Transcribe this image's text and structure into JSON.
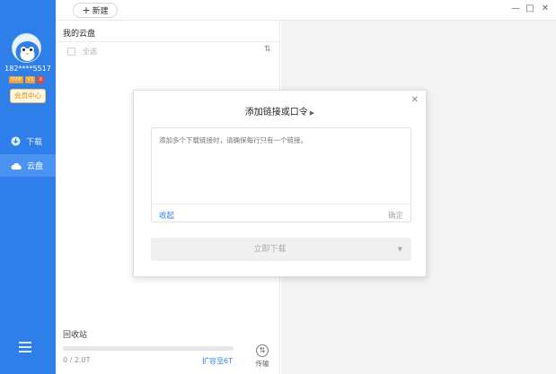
{
  "sidebar": {
    "username": "182****5517",
    "vip_badge": "SVIP",
    "vip_level": "V1",
    "vip_tag": "X",
    "member_center": "会员中心",
    "nav": [
      {
        "label": "下载",
        "icon": "download-icon"
      },
      {
        "label": "云盘",
        "icon": "cloud-icon"
      }
    ],
    "menu_icon": "hamburger-menu-icon"
  },
  "topbar": {
    "new_button": "新建",
    "window_controls": [
      "—",
      "□",
      "✕"
    ]
  },
  "panel": {
    "title": "我的云盘",
    "select_all": "全选",
    "recycle_bin": "回收站",
    "storage_used": "0 / 2.0T",
    "storage_fraction": 0,
    "expand": "扩容至6T",
    "transfer": "传输"
  },
  "dialog": {
    "title": "添加链接或口令",
    "placeholder": "添加多个下载链接时，请确保每行只有一个链接。",
    "collapse": "收起",
    "confirm": "确定",
    "download_now": "立即下载",
    "colors": {
      "accent": "#2f7fea",
      "sidebar": "#2f7fea"
    }
  }
}
